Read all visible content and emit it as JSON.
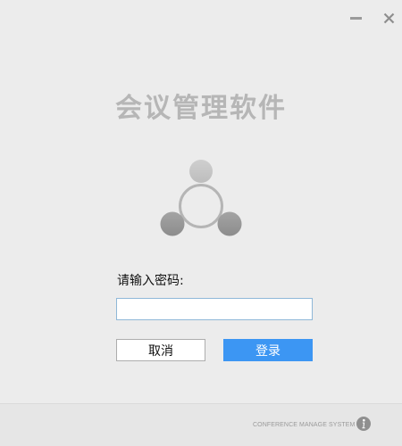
{
  "window": {
    "minimize_icon": "minimize-icon",
    "close_icon": "close-icon",
    "close_glyph": "X"
  },
  "app": {
    "title": "会议管理软件",
    "logo_icon": "three-circles-logo-icon"
  },
  "form": {
    "password_label": "请输入密码:",
    "password_value": "",
    "password_placeholder": ""
  },
  "buttons": {
    "cancel_label": "取消",
    "login_label": "登录"
  },
  "footer": {
    "text": "CONFERENCE MANAGE SYSTEM",
    "info_icon": "info-icon"
  },
  "colors": {
    "background": "#ececec",
    "primary_button": "#3c96f3",
    "title_text": "#b6b6b6",
    "input_border": "#8fb8d8"
  }
}
